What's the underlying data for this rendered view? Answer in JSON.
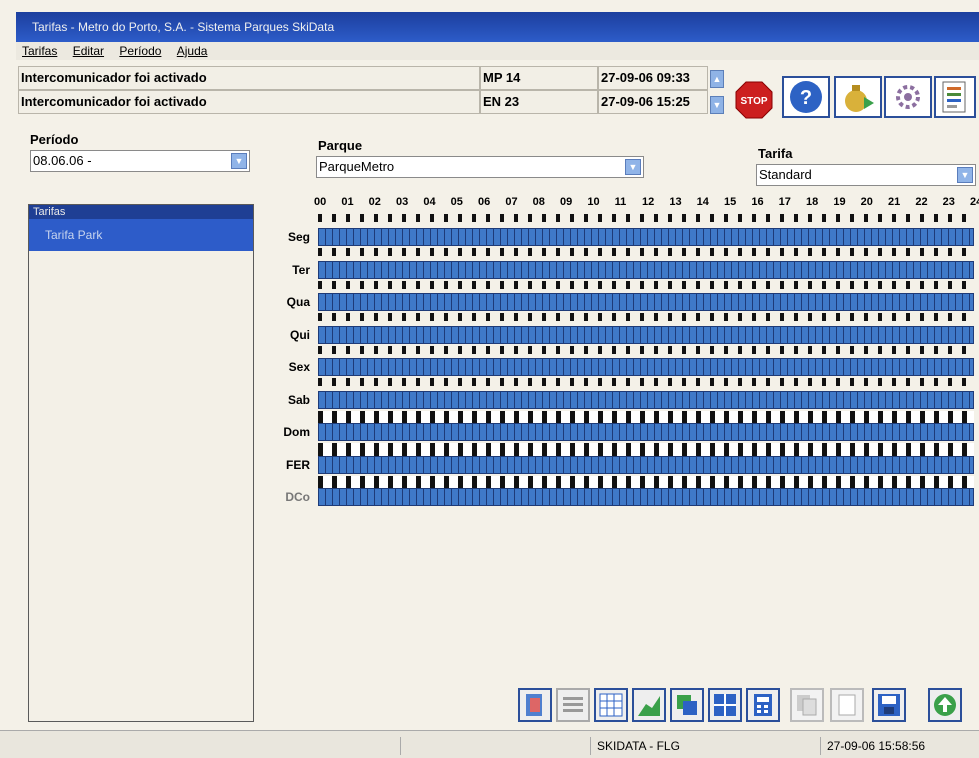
{
  "window": {
    "title": "Tarifas - Metro do Porto, S.A. - Sistema Parques SkiData"
  },
  "menu": {
    "items": [
      "Tarifas",
      "Editar",
      "Período",
      "Ajuda"
    ]
  },
  "messages": [
    {
      "text": "Intercomunicador foi activado",
      "code": "MP 14",
      "time": "27-09-06 09:33"
    },
    {
      "text": "Intercomunicador foi activado",
      "code": "EN 23",
      "time": "27-09-06 15:25"
    }
  ],
  "toolbar_top": {
    "stop_label": "STOP"
  },
  "periodo": {
    "label": "Período",
    "value": "08.06.06 -"
  },
  "parque": {
    "label": "Parque",
    "value": "ParqueMetro"
  },
  "tarifa": {
    "label": "Tarifa",
    "value": "Standard"
  },
  "tariff_panel": {
    "header": "Tarifas",
    "items": [
      "Tarifa Park"
    ]
  },
  "schedule": {
    "hours": [
      "00",
      "01",
      "02",
      "03",
      "04",
      "05",
      "06",
      "07",
      "08",
      "09",
      "10",
      "11",
      "12",
      "13",
      "14",
      "15",
      "16",
      "17",
      "18",
      "19",
      "20",
      "21",
      "22",
      "23",
      "24"
    ],
    "days": [
      "Seg",
      "Ter",
      "Qua",
      "Qui",
      "Sex",
      "Sab",
      "Dom",
      "FER",
      "DCo"
    ]
  },
  "status": {
    "station": "SKIDATA - FLG",
    "datetime": "27-09-06 15:58:56"
  },
  "colors": {
    "title_bar": "#2d5cc9",
    "bar_fill": "#3f79c8",
    "bar_border": "#1e3b78",
    "stop_red": "#cc1f1f"
  }
}
